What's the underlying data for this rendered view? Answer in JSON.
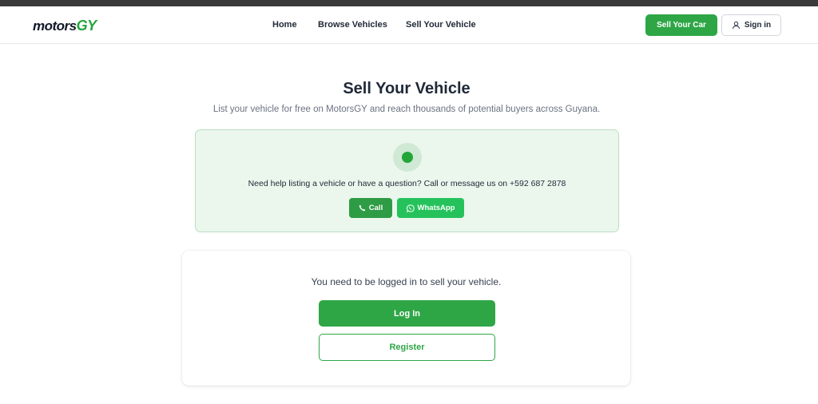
{
  "header": {
    "logo_prefix": "motors",
    "logo_suffix": "GY",
    "nav": [
      {
        "label": "Home"
      },
      {
        "label": "Browse Vehicles"
      },
      {
        "label": "Sell Your Vehicle"
      }
    ],
    "sell_car_label": "Sell Your Car",
    "sign_in_label": "Sign in",
    "sign_in_icon": "user-icon"
  },
  "main": {
    "title": "Sell Your Vehicle",
    "subtitle": "List your vehicle for free on MotorsGY and reach thousands of potential buyers across Guyana."
  },
  "help": {
    "text": "Need help listing a vehicle or have a question? Call or message us on +592 687 2878",
    "call_label": "Call",
    "call_icon": "phone-icon",
    "whatsapp_label": "WhatsApp",
    "whatsapp_icon": "whatsapp-icon"
  },
  "login_card": {
    "message": "You need to be logged in to sell your vehicle.",
    "login_label": "Log In",
    "register_label": "Register"
  },
  "colors": {
    "brand_green": "#2ea646",
    "whatsapp_green": "#25c25b",
    "help_bg": "#ebf6ed"
  }
}
